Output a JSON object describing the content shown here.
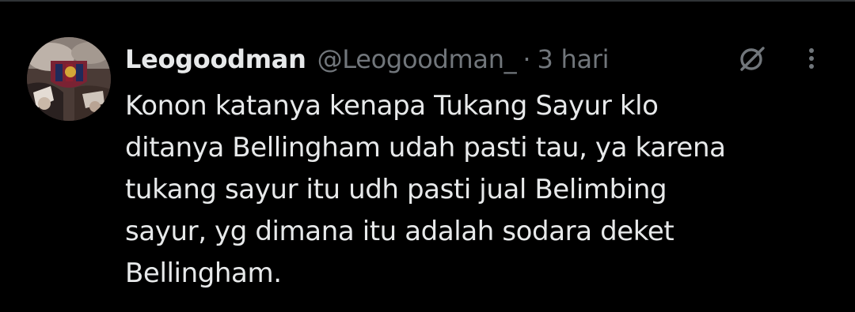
{
  "tweet": {
    "author": {
      "display_name": "Leogoodman",
      "handle": "@Leogoodman_",
      "avatar_icon": "profile-photo-avatar"
    },
    "separator": "·",
    "timestamp": "3 hari",
    "text_lines": [
      "Konon katanya kenapa Tukang Sayur klo",
      "ditanya Bellingham udah pasti tau, ya karena",
      "tukang sayur itu udh pasti jual Belimbing",
      "sayur, yg dimana itu adalah sodara deket",
      "Bellingham."
    ],
    "actions": {
      "grok_icon": "grok-icon",
      "more_icon": "more-options-icon"
    }
  },
  "colors": {
    "background": "#000000",
    "primary_text": "#e7e9ea",
    "secondary_text": "#71767b",
    "divider": "#2f3336"
  }
}
